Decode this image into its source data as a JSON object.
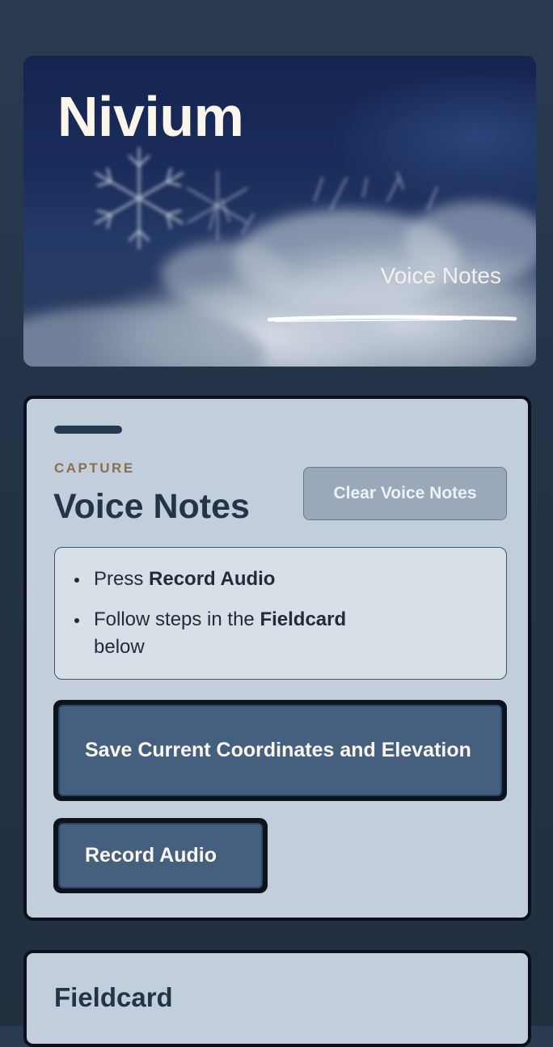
{
  "hero": {
    "title": "Nivium",
    "subtitle": "Voice Notes"
  },
  "capture": {
    "eyebrow": "CAPTURE",
    "title": "Voice Notes",
    "clear_button": "Clear Voice Notes",
    "instructions": {
      "item1_prefix": "Press ",
      "item1_bold": "Record Audio",
      "item2_prefix": "Follow steps in the ",
      "item2_bold": "Fieldcard",
      "item2_suffix": " below"
    },
    "save_coordinates_button": "Save Current Coordinates and Elevation",
    "record_audio_button": "Record Audio"
  },
  "fieldcard": {
    "title": "Fieldcard"
  },
  "colors": {
    "background": "#243448",
    "card": "#c2cedb",
    "primary_button": "#44607e",
    "eyebrow": "#8a6f52"
  }
}
